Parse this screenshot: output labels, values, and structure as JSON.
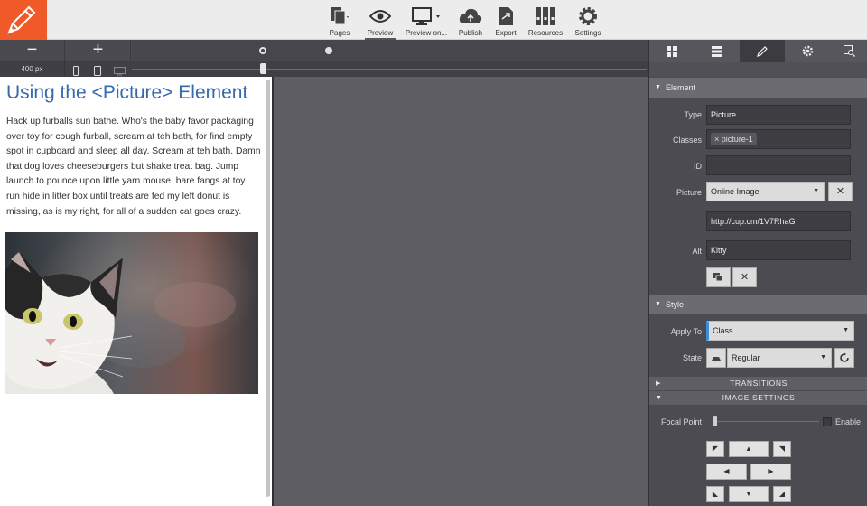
{
  "toolbar": {
    "pages": "Pages",
    "preview": "Preview",
    "preview_on": "Preview on...",
    "publish": "Publish",
    "export": "Export",
    "resources": "Resources",
    "settings": "Settings"
  },
  "zoombar": {
    "minus": "−",
    "plus": "+",
    "width_label": "400 px"
  },
  "page": {
    "title": "Using the <Picture> Element",
    "body": "Hack up furballs sun bathe. Who's the baby favor packaging over toy for cough furball, scream at teh bath, for find empty spot in cupboard and sleep all day. Scream at teh bath. Damn that dog loves cheeseburgers but shake treat bag. Jump launch to pounce upon little yarn mouse, bare fangs at toy run hide in litter box until treats are fed my left donut is missing, as is my right, for all of a sudden cat goes crazy."
  },
  "panel": {
    "element_section": "Element",
    "type_label": "Type",
    "type_value": "Picture",
    "classes_label": "Classes",
    "class_tag": "picture-1",
    "id_label": "ID",
    "id_value": "",
    "picture_label": "Picture",
    "picture_source": "Online Image",
    "url_value": "http://cup.cm/1V7RhaG",
    "alt_label": "Alt",
    "alt_value": "Kitty",
    "style_section": "Style",
    "apply_to_label": "Apply To",
    "apply_to_value": "Class",
    "state_label": "State",
    "state_value": "Regular",
    "transitions": "TRANSITIONS",
    "image_settings": "IMAGE SETTINGS",
    "focal_point_label": "Focal Point",
    "enable_label": "Enable"
  },
  "colors": {
    "brand_orange": "#f05a28",
    "title_blue": "#3769ad",
    "panel_bg": "#4b4b51"
  }
}
